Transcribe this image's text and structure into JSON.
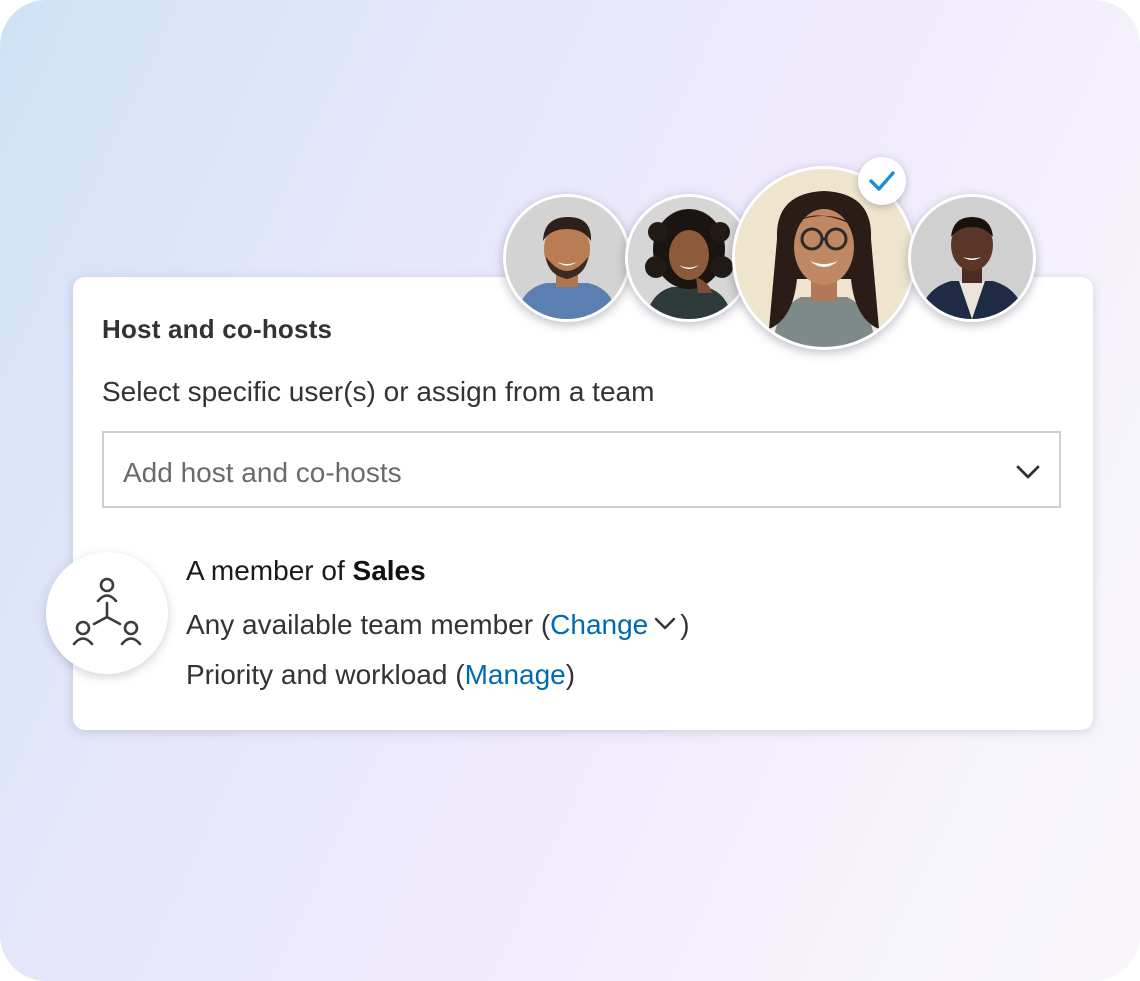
{
  "panel": {
    "title": "Host and co-hosts",
    "subtitle": "Select specific user(s) or assign from a team",
    "host_select": {
      "placeholder": "Add host and co-hosts",
      "icon": "chevron-down-icon"
    },
    "team": {
      "icon": "team-network-icon",
      "member_prefix": "A member of ",
      "team_name": "Sales",
      "assignment_prefix": "Any available team member (",
      "assignment_link": "Change",
      "assignment_suffix": ")",
      "priority_prefix": "Priority and workload (",
      "priority_link": "Manage",
      "priority_suffix": ")"
    }
  },
  "avatars": [
    {
      "name": "avatar-1",
      "selected": false
    },
    {
      "name": "avatar-2",
      "selected": false
    },
    {
      "name": "avatar-3",
      "selected": true
    },
    {
      "name": "avatar-4",
      "selected": false
    }
  ],
  "colors": {
    "link": "#0069b4",
    "text": "#333333",
    "check": "#1a8fd6"
  }
}
